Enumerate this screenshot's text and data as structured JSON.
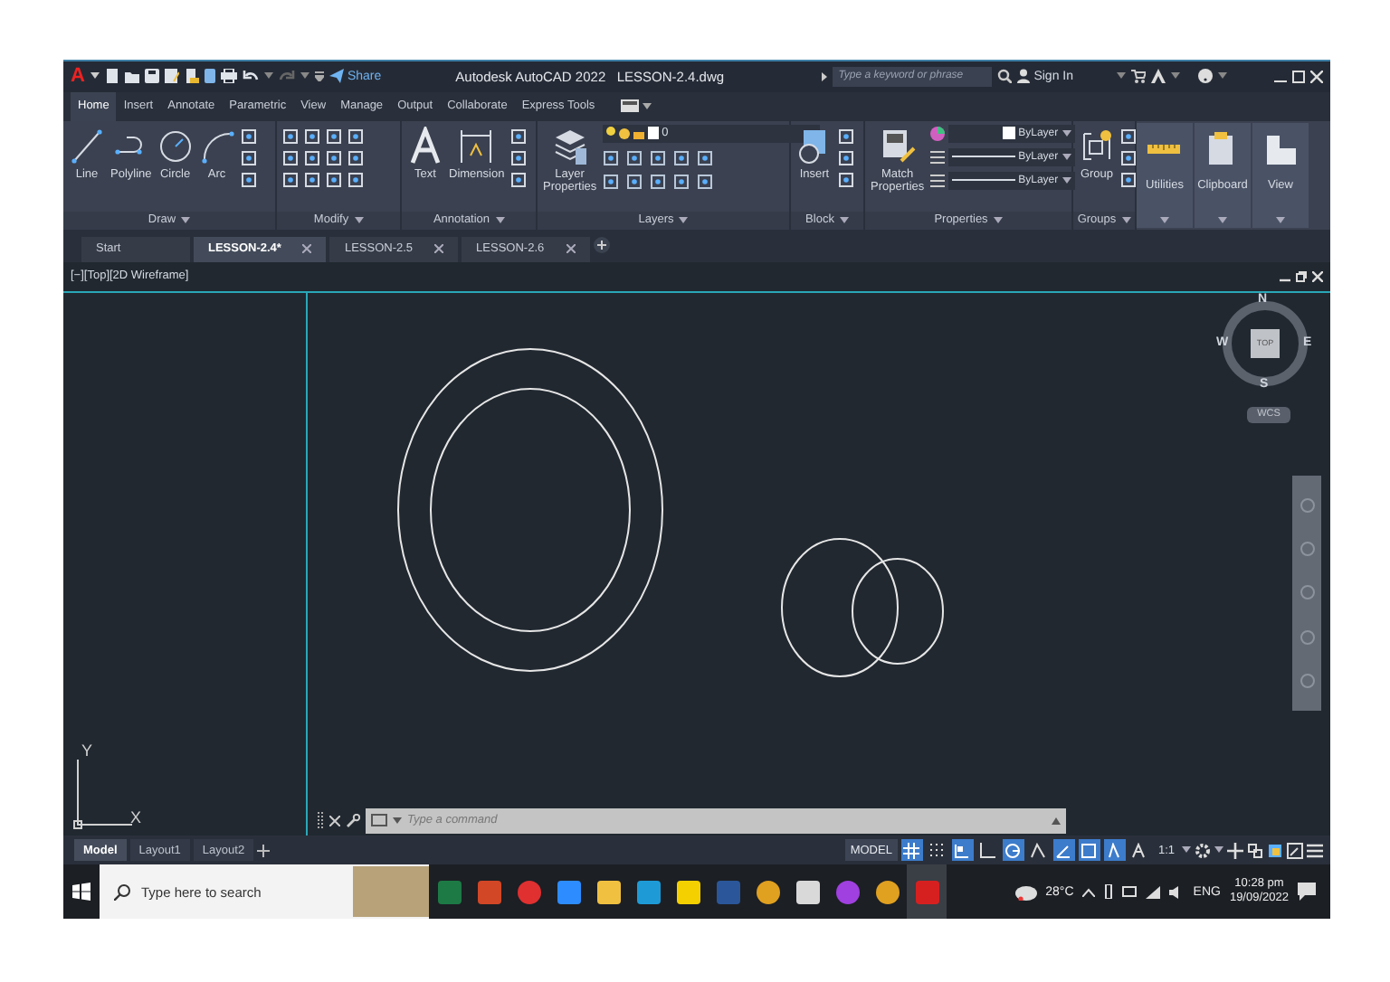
{
  "title_bar": {
    "logo": "A",
    "share": "Share",
    "title": "Autodesk AutoCAD 2022",
    "file": "LESSON-2.4.dwg",
    "search": {
      "placeholder": "Type a keyword or phrase"
    },
    "sign_in": "Sign In"
  },
  "ribbon_tabs": [
    {
      "label": "Home",
      "selected": true
    },
    {
      "label": "Insert",
      "selected": false
    },
    {
      "label": "Annotate",
      "selected": false
    },
    {
      "label": "Parametric",
      "selected": false
    },
    {
      "label": "View",
      "selected": false
    },
    {
      "label": "Manage",
      "selected": false
    },
    {
      "label": "Output",
      "selected": false
    },
    {
      "label": "Collaborate",
      "selected": false
    },
    {
      "label": "Express Tools",
      "selected": false
    }
  ],
  "panels": [
    {
      "title": "Draw",
      "kind": "draw",
      "tools": [
        {
          "label": "Line",
          "kind": "line"
        },
        {
          "label": "Polyline",
          "kind": "polyline"
        },
        {
          "label": "Circle",
          "kind": "circle"
        },
        {
          "label": "Arc",
          "kind": "arc"
        }
      ]
    },
    {
      "title": "Modify",
      "kind": "modify"
    },
    {
      "title": "Annotation",
      "kind": "annotation",
      "tools": [
        {
          "label": "Text",
          "kind": "text"
        },
        {
          "label": "Dimension",
          "kind": "dimension"
        }
      ]
    },
    {
      "title": "Layers",
      "kind": "layers",
      "tools": [
        {
          "label": "Layer Properties",
          "kind": "layers"
        }
      ],
      "layer": "0"
    },
    {
      "title": "Block",
      "kind": "block",
      "tools": [
        {
          "label": "Insert",
          "kind": "insert"
        }
      ]
    },
    {
      "title": "Properties",
      "kind": "properties",
      "tools": [
        {
          "label": "Match Properties",
          "kind": "match"
        }
      ],
      "dropdowns": [
        "ByLayer",
        "ByLayer",
        "ByLayer"
      ]
    },
    {
      "title": "Groups",
      "kind": "groups",
      "tools": [
        {
          "label": "Group",
          "kind": "group"
        }
      ]
    }
  ],
  "collapsed_panels": [
    {
      "label": "Utilities",
      "kind": "utilities"
    },
    {
      "label": "Clipboard",
      "kind": "clipboard"
    },
    {
      "label": "View",
      "kind": "view"
    }
  ],
  "file_tabs": [
    {
      "label": "Start",
      "selected": false,
      "closable": false
    },
    {
      "label": "LESSON-2.4*",
      "selected": true,
      "closable": true
    },
    {
      "label": "LESSON-2.5",
      "selected": false,
      "closable": true
    },
    {
      "label": "LESSON-2.6",
      "selected": false,
      "closable": true
    }
  ],
  "viewport": {
    "label": "[−][Top][2D Wireframe]",
    "viewcube": {
      "top": "TOP",
      "north": "N",
      "south": "S",
      "east": "E",
      "west": "W"
    },
    "ucs": "WCS",
    "axes": {
      "x": "X",
      "y": "Y"
    }
  },
  "command_line": {
    "placeholder": "Type a command"
  },
  "layout_tabs": [
    {
      "label": "Model",
      "selected": true
    },
    {
      "label": "Layout1",
      "selected": false
    },
    {
      "label": "Layout2",
      "selected": false
    }
  ],
  "status_bar": {
    "model": "MODEL",
    "scale": "1:1",
    "toggles": [
      {
        "kind": "grid",
        "on": true
      },
      {
        "kind": "snap",
        "on": false
      },
      {
        "kind": "infer",
        "on": true
      },
      {
        "kind": "ortho",
        "on": false
      },
      {
        "kind": "polar",
        "on": true
      },
      {
        "kind": "isodraft",
        "on": false
      },
      {
        "kind": "tracking",
        "on": true
      },
      {
        "kind": "osnap",
        "on": true
      },
      {
        "kind": "annotation",
        "on": true
      },
      {
        "kind": "autoscale",
        "on": false
      }
    ]
  },
  "taskbar": {
    "search": {
      "placeholder": "Type here to search"
    },
    "weather": "28°C",
    "language": "ENG",
    "time": "10:28 pm",
    "date": "19/09/2022",
    "apps": [
      {
        "kind": "sheet",
        "active": false
      },
      {
        "kind": "slides",
        "active": false
      },
      {
        "kind": "recorder",
        "active": false
      },
      {
        "kind": "video",
        "active": false
      },
      {
        "kind": "folder",
        "active": false
      },
      {
        "kind": "browser",
        "active": false
      },
      {
        "kind": "notes",
        "active": false
      },
      {
        "kind": "doc",
        "active": false
      },
      {
        "kind": "chrome",
        "active": false
      },
      {
        "kind": "image",
        "active": false
      },
      {
        "kind": "messenger",
        "active": false
      },
      {
        "kind": "chrome",
        "active": false
      },
      {
        "kind": "cad",
        "active": true
      }
    ]
  }
}
